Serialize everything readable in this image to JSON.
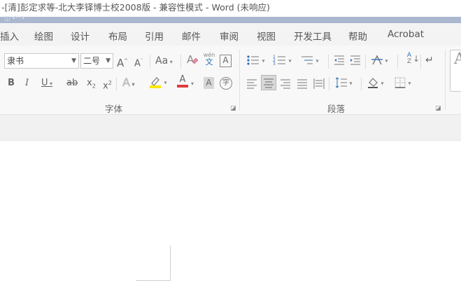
{
  "window": {
    "title": "-[清]彭定求等-北大李铎博士校2008版  -  兼容性模式 - Word (未响应)"
  },
  "tabs": [
    {
      "label": "插入"
    },
    {
      "label": "绘图"
    },
    {
      "label": "设计"
    },
    {
      "label": "布局"
    },
    {
      "label": "引用"
    },
    {
      "label": "邮件"
    },
    {
      "label": "审阅"
    },
    {
      "label": "视图"
    },
    {
      "label": "开发工具"
    },
    {
      "label": "帮助"
    },
    {
      "label": "Acrobat"
    }
  ],
  "font_group": {
    "font_name": "隶书",
    "font_size": "二号",
    "grow_label": "A",
    "shrink_label": "A",
    "case_label": "Aa",
    "phonetic_top": "wén",
    "phonetic_bottom": "文",
    "border_char_label": "A",
    "bold": "B",
    "italic": "I",
    "underline": "U",
    "strike": "ab",
    "subscript": "x",
    "subscript_mark": "2",
    "superscript": "x",
    "superscript_mark": "2",
    "effects_label": "A",
    "font_color_label": "A",
    "shading_label": "A",
    "enclose_label": "字",
    "group_label": "字体"
  },
  "paragraph_group": {
    "sort_top": "A",
    "sort_bottom": "Z",
    "group_label": "段落"
  },
  "styles_preview": "A",
  "colors": {
    "accent_strip": "#aab7cf",
    "highlight": "#ffe600",
    "font_color": "#e03c3c",
    "icon_blue": "#2f6fb5"
  }
}
